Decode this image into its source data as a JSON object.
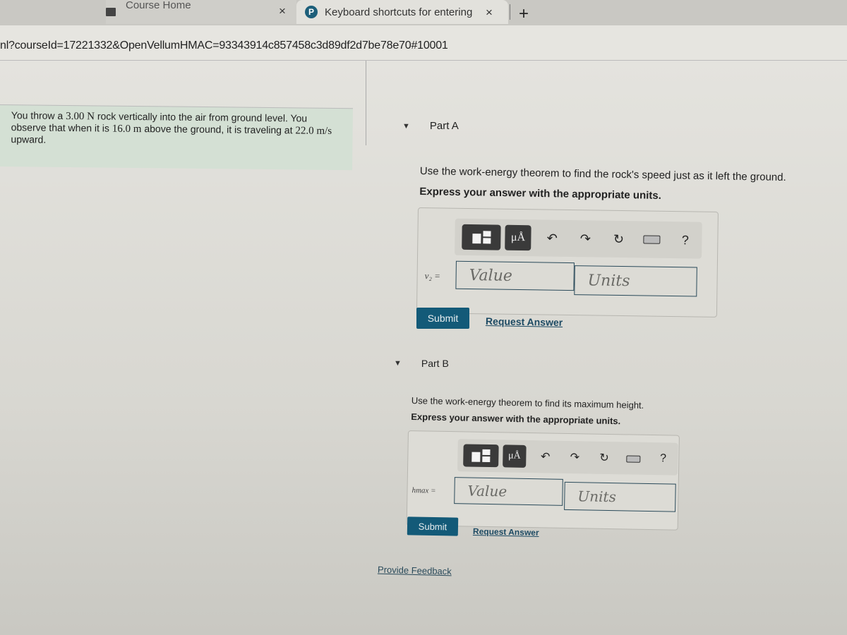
{
  "browser": {
    "tabs": [
      {
        "title": "Course Home",
        "icon": "book-icon"
      },
      {
        "title": "Keyboard shortcuts for entering",
        "icon": "pearson-p-logo"
      }
    ],
    "new_tab_label": "+",
    "close_label": "×",
    "url": "nl?courseId=17221332&OpenVellumHMAC=93343914c857458c3d89df2d7be78e70#10001"
  },
  "problem": {
    "text_1": "You throw a ",
    "weight": "3.00 N",
    "text_2": " rock vertically into the air from ground level. You observe that when it is ",
    "height": "16.0 m",
    "text_3": " above the ground, it is traveling at ",
    "speed": "22.0 m/s",
    "text_4": " upward."
  },
  "parts": [
    {
      "title": "Part A",
      "instruction": "Use the work-energy theorem to find the rock's speed just as it left the ground.",
      "format_note": "Express your answer with the appropriate units.",
      "variable": "v₂ =",
      "value_placeholder": "Value",
      "units_placeholder": "Units",
      "submit_label": "Submit",
      "request_label": "Request Answer"
    },
    {
      "title": "Part B",
      "instruction": "Use the work-energy theorem to find its maximum height.",
      "format_note": "Express your answer with the appropriate units.",
      "variable": "hmax =",
      "value_placeholder": "Value",
      "units_placeholder": "Units",
      "submit_label": "Submit",
      "request_label": "Request Answer"
    }
  ],
  "toolbar": {
    "units_label": "μÅ",
    "undo": "↶",
    "redo": "↷",
    "reset": "↻",
    "help": "?"
  },
  "feedback_label": "Provide Feedback"
}
